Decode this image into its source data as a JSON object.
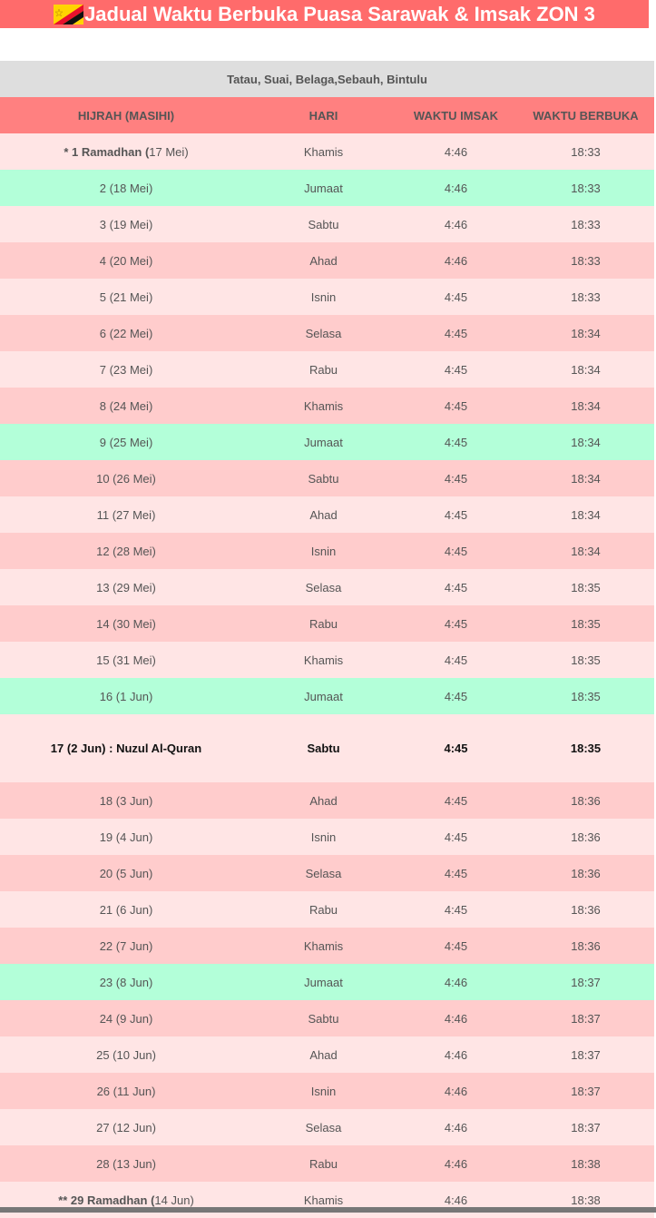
{
  "title": "Jadual Waktu Berbuka Puasa Sarawak & Imsak ZON 3",
  "zone": "Tatau, Suai, Belaga,Sebauh, Bintulu",
  "columns": [
    "HIJRAH (MASIHI)",
    "HARI",
    "WAKTU IMSAK",
    "WAKTU BERBUKA"
  ],
  "colors": {
    "title_bg": "#ff6b6b",
    "header_bg": "#ff8080",
    "zone_bg": "#dedede",
    "row_light": "#ffe5e5",
    "row_dark": "#ffcccc",
    "row_friday": "#b3ffd9"
  },
  "rows": [
    {
      "hijrah": "1 Ramadhan",
      "prefix": "* ",
      "masihi": "17 Mei",
      "hari": "Khamis",
      "imsak": "4:46",
      "berbuka": "18:33",
      "style": "light",
      "kind": "first"
    },
    {
      "hijrah": "2",
      "masihi": "18 Mei",
      "hari": "Jumaat",
      "imsak": "4:46",
      "berbuka": "18:33",
      "style": "friday"
    },
    {
      "hijrah": "3",
      "masihi": "19 Mei",
      "hari": "Sabtu",
      "imsak": "4:46",
      "berbuka": "18:33",
      "style": "light"
    },
    {
      "hijrah": "4",
      "masihi": "20 Mei",
      "hari": "Ahad",
      "imsak": "4:46",
      "berbuka": "18:33",
      "style": "dark"
    },
    {
      "hijrah": "5",
      "masihi": "21 Mei",
      "hari": "Isnin",
      "imsak": "4:45",
      "berbuka": "18:33",
      "style": "light"
    },
    {
      "hijrah": "6",
      "masihi": "22 Mei",
      "hari": "Selasa",
      "imsak": "4:45",
      "berbuka": "18:34",
      "style": "dark"
    },
    {
      "hijrah": "7",
      "masihi": "23 Mei",
      "hari": "Rabu",
      "imsak": "4:45",
      "berbuka": "18:34",
      "style": "light"
    },
    {
      "hijrah": "8",
      "masihi": "24 Mei",
      "hari": "Khamis",
      "imsak": "4:45",
      "berbuka": "18:34",
      "style": "dark"
    },
    {
      "hijrah": "9",
      "masihi": "25 Mei",
      "hari": "Jumaat",
      "imsak": "4:45",
      "berbuka": "18:34",
      "style": "friday"
    },
    {
      "hijrah": "10",
      "masihi": "26 Mei",
      "hari": "Sabtu",
      "imsak": "4:45",
      "berbuka": "18:34",
      "style": "dark"
    },
    {
      "hijrah": "11",
      "masihi": "27 Mei",
      "hari": "Ahad",
      "imsak": "4:45",
      "berbuka": "18:34",
      "style": "light"
    },
    {
      "hijrah": "12",
      "masihi": "28 Mei",
      "hari": "Isnin",
      "imsak": "4:45",
      "berbuka": "18:34",
      "style": "dark"
    },
    {
      "hijrah": "13",
      "masihi": "29 Mei",
      "hari": "Selasa",
      "imsak": "4:45",
      "berbuka": "18:35",
      "style": "light"
    },
    {
      "hijrah": "14",
      "masihi": "30 Mei",
      "hari": "Rabu",
      "imsak": "4:45",
      "berbuka": "18:35",
      "style": "dark"
    },
    {
      "hijrah": "15",
      "masihi": "31 Mei",
      "hari": "Khamis",
      "imsak": "4:45",
      "berbuka": "18:35",
      "style": "light"
    },
    {
      "hijrah": "16",
      "masihi": "1 Jun",
      "hari": "Jumaat",
      "imsak": "4:45",
      "berbuka": "18:35",
      "style": "friday"
    },
    {
      "hijrah": "17",
      "masihi": "2 Jun",
      "suffix": " : Nuzul Al-Quran",
      "hari": "Sabtu",
      "imsak": "4:45",
      "berbuka": "18:35",
      "style": "light",
      "kind": "special"
    },
    {
      "hijrah": "18",
      "masihi": "3 Jun",
      "hari": "Ahad",
      "imsak": "4:45",
      "berbuka": "18:36",
      "style": "dark"
    },
    {
      "hijrah": "19",
      "masihi": "4 Jun",
      "hari": "Isnin",
      "imsak": "4:45",
      "berbuka": "18:36",
      "style": "light"
    },
    {
      "hijrah": "20",
      "masihi": "5 Jun",
      "hari": "Selasa",
      "imsak": "4:45",
      "berbuka": "18:36",
      "style": "dark"
    },
    {
      "hijrah": "21",
      "masihi": "6 Jun",
      "hari": "Rabu",
      "imsak": "4:45",
      "berbuka": "18:36",
      "style": "light"
    },
    {
      "hijrah": "22",
      "masihi": "7 Jun",
      "hari": "Khamis",
      "imsak": "4:45",
      "berbuka": "18:36",
      "style": "dark"
    },
    {
      "hijrah": "23",
      "masihi": "8 Jun",
      "hari": "Jumaat",
      "imsak": "4:46",
      "berbuka": "18:37",
      "style": "friday"
    },
    {
      "hijrah": "24",
      "masihi": "9 Jun",
      "hari": "Sabtu",
      "imsak": "4:46",
      "berbuka": "18:37",
      "style": "dark"
    },
    {
      "hijrah": "25",
      "masihi": "10 Jun",
      "hari": "Ahad",
      "imsak": "4:46",
      "berbuka": "18:37",
      "style": "light"
    },
    {
      "hijrah": "26",
      "masihi": "11 Jun",
      "hari": "Isnin",
      "imsak": "4:46",
      "berbuka": "18:37",
      "style": "dark"
    },
    {
      "hijrah": "27",
      "masihi": "12 Jun",
      "hari": "Selasa",
      "imsak": "4:46",
      "berbuka": "18:37",
      "style": "light"
    },
    {
      "hijrah": "28",
      "masihi": "13 Jun",
      "hari": "Rabu",
      "imsak": "4:46",
      "berbuka": "18:38",
      "style": "dark"
    },
    {
      "hijrah": "29 Ramadhan",
      "prefix": "** ",
      "masihi": "14 Jun",
      "hari": "Khamis",
      "imsak": "4:46",
      "berbuka": "18:38",
      "style": "light",
      "kind": "first"
    }
  ]
}
